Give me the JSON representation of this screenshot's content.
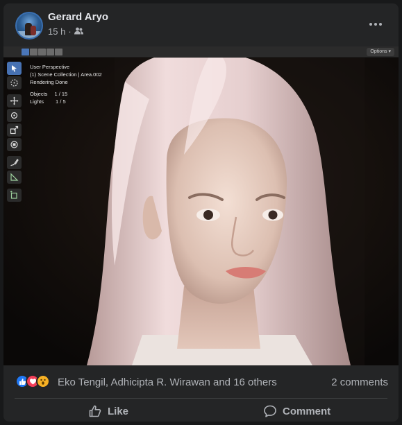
{
  "post": {
    "author": "Gerard Aryo",
    "time": "15 h",
    "audience_icon": "friends-icon",
    "more_icon": "more-options-icon"
  },
  "viewport": {
    "options_label": "Options",
    "info": {
      "view": "User Perspective",
      "collection": "(1) Scene Collection | Area.002",
      "status": "Rendering Done",
      "objects_label": "Objects",
      "objects_value": "1 / 15",
      "lights_label": "Lights",
      "lights_value": "1 / 5"
    },
    "tools": [
      "select-box-icon",
      "cursor-icon",
      "move-icon",
      "rotate-icon",
      "scale-icon",
      "transform-icon",
      "annotate-icon",
      "measure-icon",
      "add-cube-icon"
    ]
  },
  "reactions": {
    "icons": [
      "like-reaction-icon",
      "love-reaction-icon",
      "wow-reaction-icon"
    ],
    "names": "Eko Tengil, Adhicipta R. Wirawan and 16 others",
    "comments": "2 comments"
  },
  "actions": {
    "like_label": "Like",
    "comment_label": "Comment"
  },
  "colors": {
    "background": "#18191a",
    "card": "#242526",
    "text_primary": "#e4e6eb",
    "text_secondary": "#b0b3b8",
    "like_blue": "#2078f4",
    "love_red": "#f33e58",
    "wow_yellow": "#f7b125",
    "blender_active": "#4772b3"
  }
}
